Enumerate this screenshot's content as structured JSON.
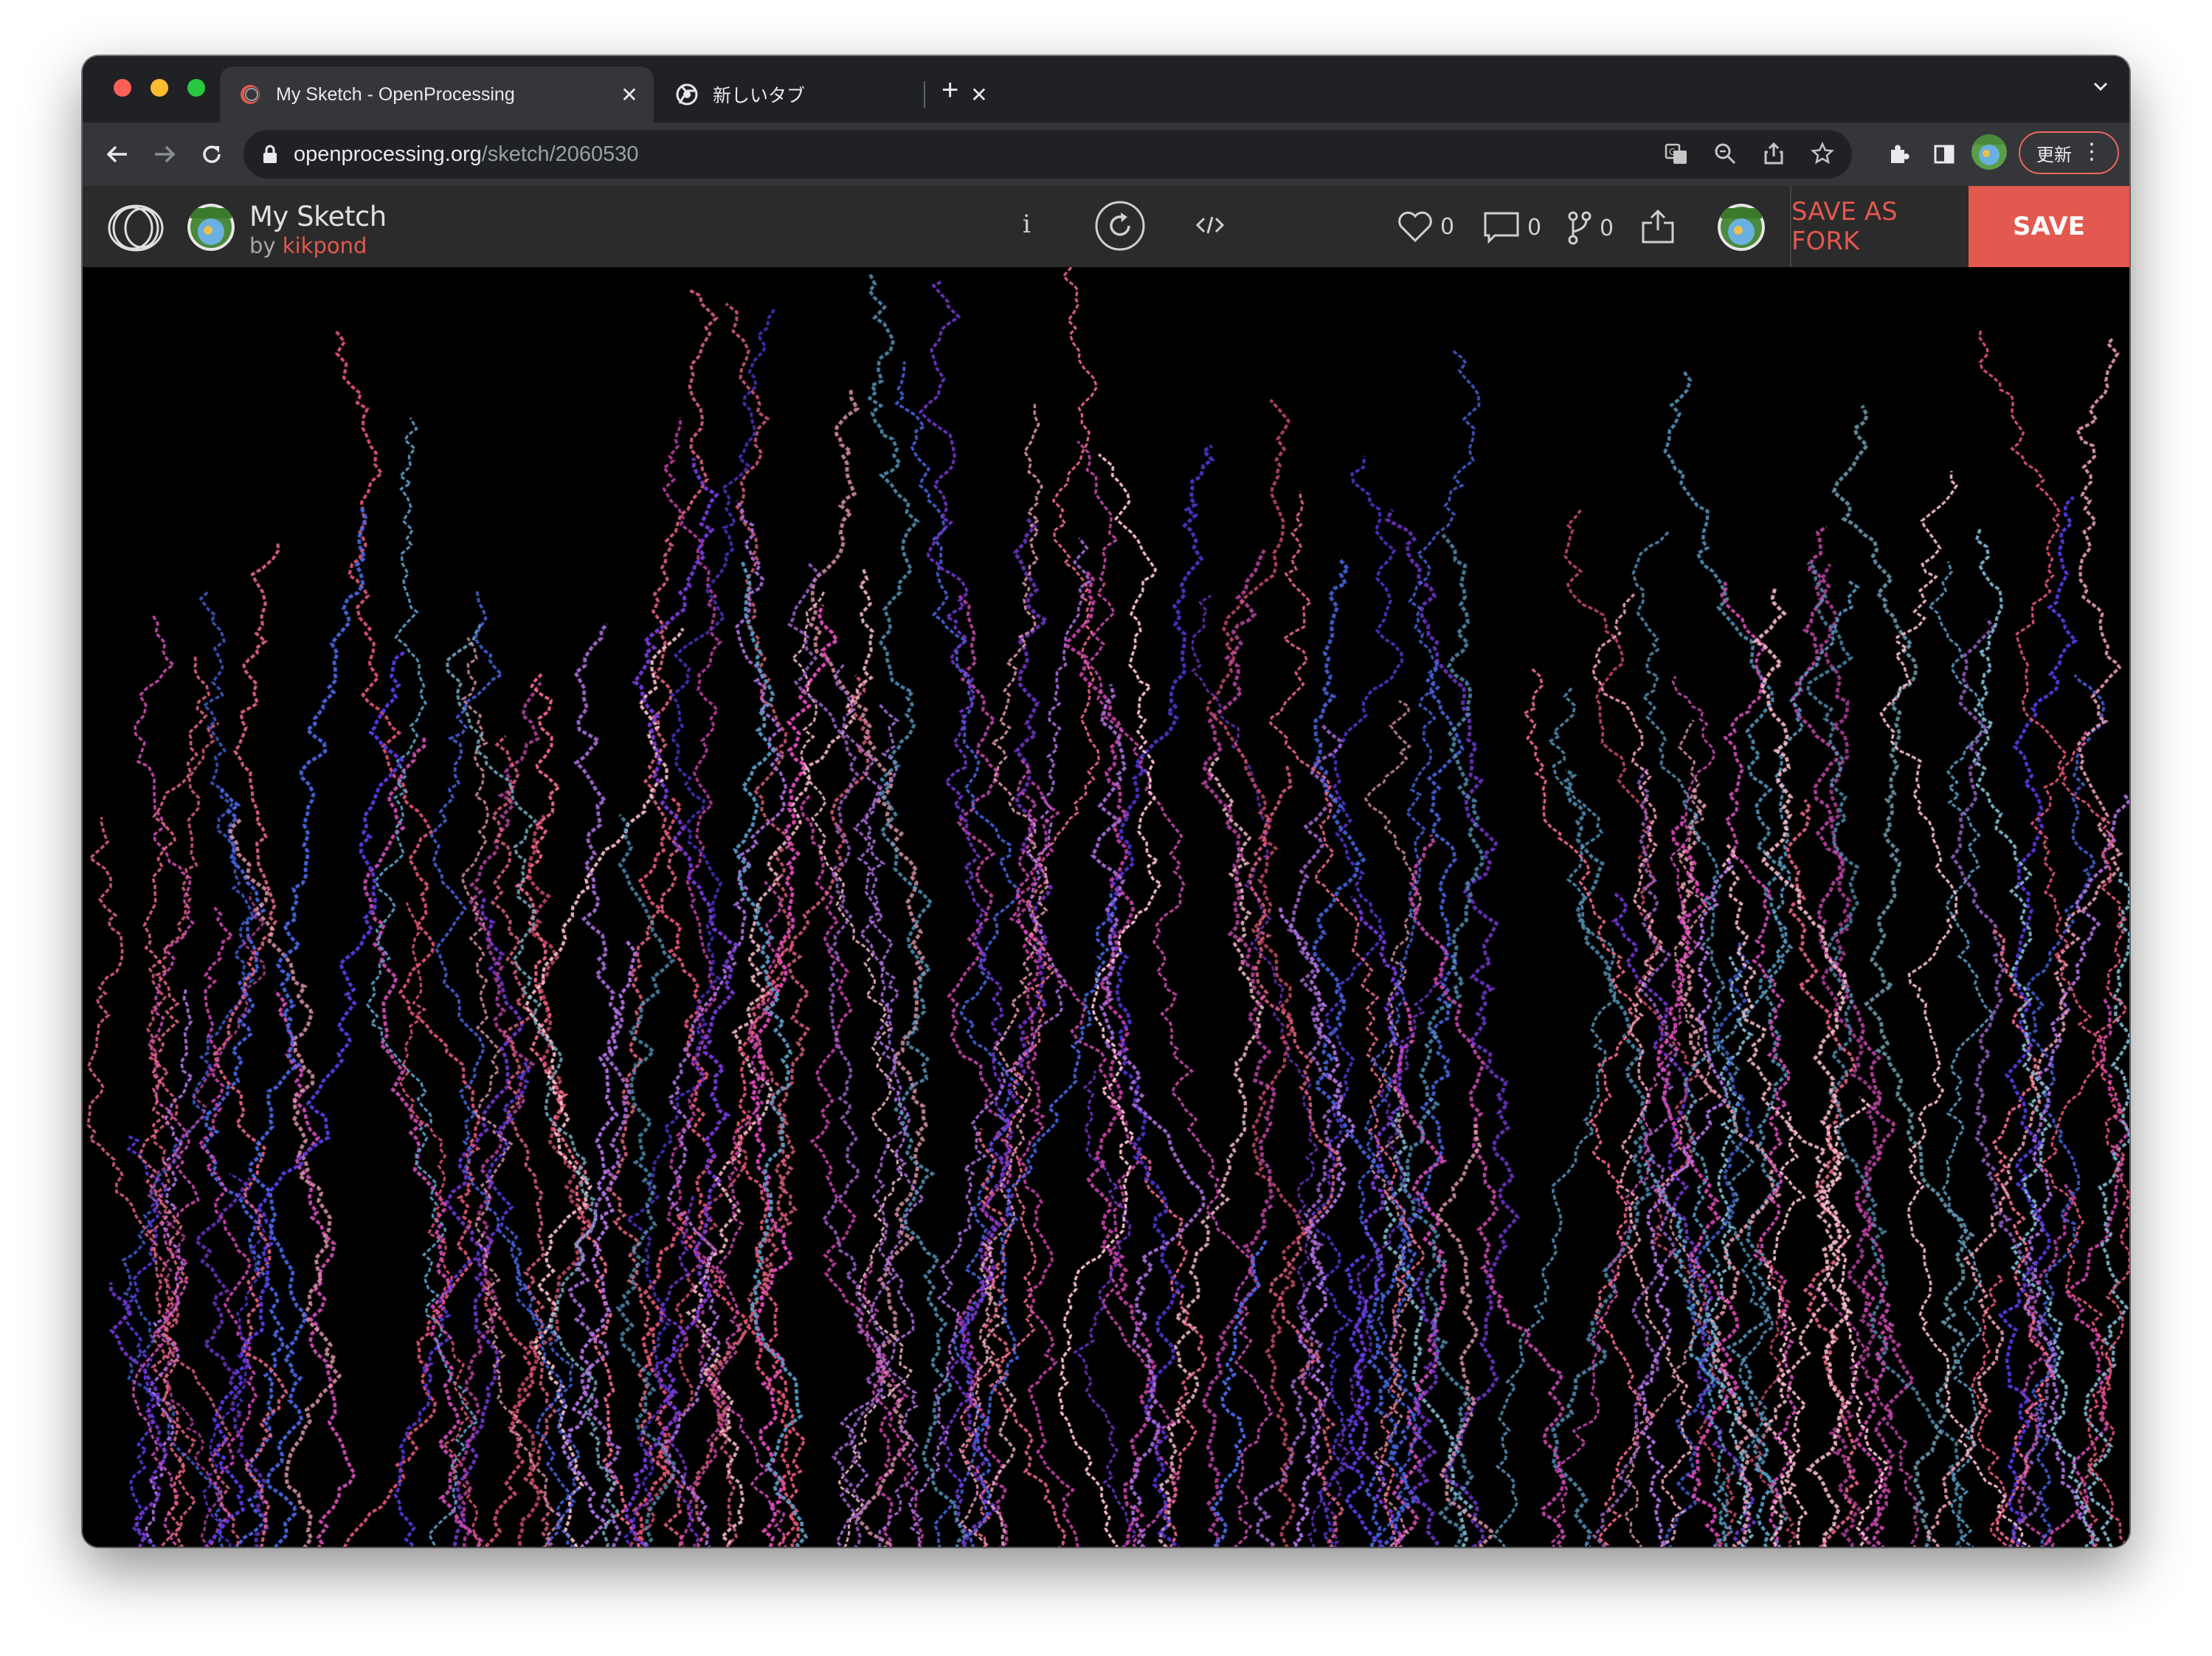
{
  "browser": {
    "tabs": [
      {
        "title": "My Sketch - OpenProcessing",
        "active": true,
        "favicon": "openprocessing-favicon",
        "close": "✕"
      },
      {
        "title": "新しいタブ",
        "active": false,
        "favicon": "chrome-favicon",
        "close": "✕"
      }
    ],
    "new_tab_label": "+",
    "url_host": "openprocessing.org",
    "url_path": "/sketch/2060530",
    "update_label": "更新"
  },
  "openprocessing": {
    "sketch_title": "My Sketch",
    "by_label": "by",
    "author": "kikpond",
    "info_label": "i",
    "likes": "0",
    "comments": "0",
    "forks": "0",
    "save_as_fork_label": "SAVE AS FORK",
    "save_label": "SAVE"
  },
  "sketch": {
    "background": "#000000",
    "palette": [
      "#e8587a",
      "#f06a8a",
      "#c94ab0",
      "#e34bc0",
      "#7a3ad8",
      "#5a3ae0",
      "#4a6ae8",
      "#5b9fc8",
      "#7fb8d0",
      "#f0a0b8",
      "#ffc0d0",
      "#b070e0"
    ]
  },
  "colors": {
    "accent": "#e3584f",
    "header_bg": "#2b2b2b",
    "tabstrip_bg": "#202124",
    "toolbar_bg": "#35363a"
  }
}
